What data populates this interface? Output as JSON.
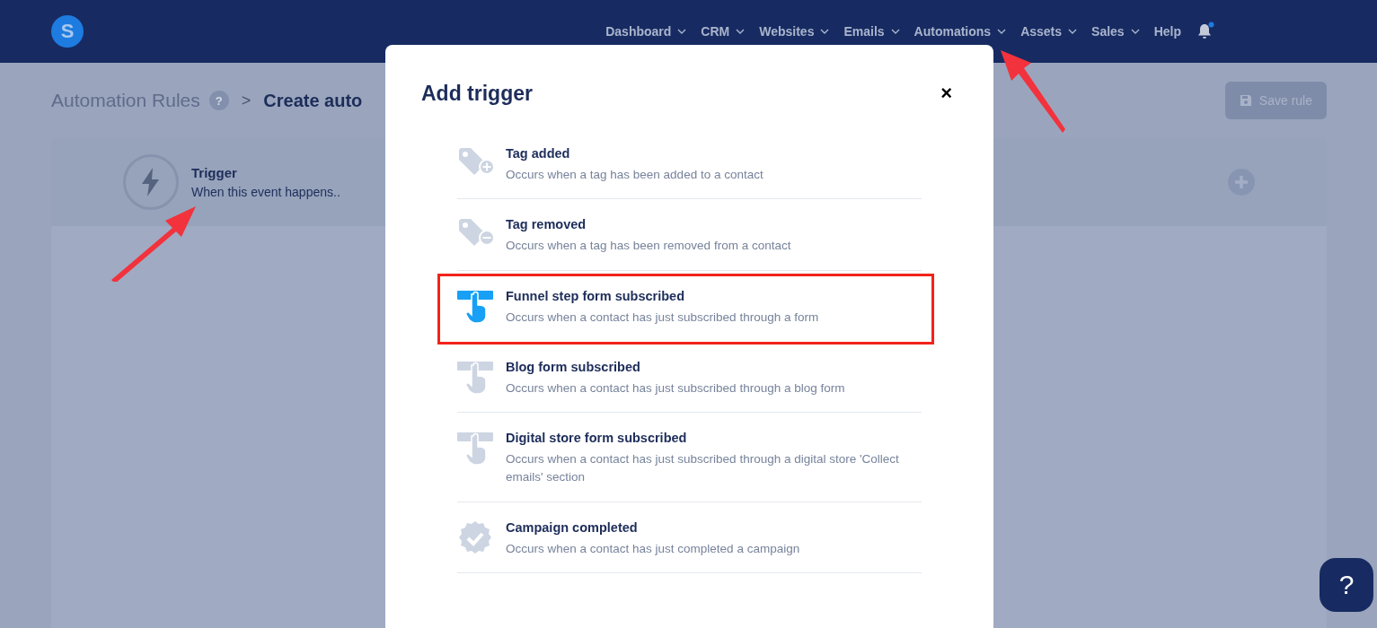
{
  "nav": {
    "logo": "S",
    "items": [
      {
        "label": "Dashboard",
        "dropdown": true
      },
      {
        "label": "CRM",
        "dropdown": true
      },
      {
        "label": "Websites",
        "dropdown": true
      },
      {
        "label": "Emails",
        "dropdown": true
      },
      {
        "label": "Automations",
        "dropdown": true
      },
      {
        "label": "Assets",
        "dropdown": true
      },
      {
        "label": "Sales",
        "dropdown": true
      },
      {
        "label": "Help",
        "dropdown": false
      }
    ],
    "notification_dot": true
  },
  "breadcrumb": {
    "parent": "Automation Rules",
    "help": "?",
    "separator": ">",
    "current": "Create auto"
  },
  "save_button": {
    "label": "Save rule",
    "disabled": true
  },
  "trigger_card": {
    "title": "Trigger",
    "subtitle": "When this event happens.."
  },
  "modal": {
    "title": "Add trigger",
    "close": "×",
    "items": [
      {
        "kind": "tag-add",
        "title": "Tag added",
        "description": "Occurs when a tag has been added to a contact",
        "highlighted": false
      },
      {
        "kind": "tag-remove",
        "title": "Tag removed",
        "description": "Occurs when a tag has been removed from a contact",
        "highlighted": false
      },
      {
        "kind": "form-active",
        "title": "Funnel step form subscribed",
        "description": "Occurs when a contact has just subscribed through a form",
        "highlighted": true
      },
      {
        "kind": "form",
        "title": "Blog form subscribed",
        "description": "Occurs when a contact has just subscribed through a blog form",
        "highlighted": false
      },
      {
        "kind": "form",
        "title": "Digital store form subscribed",
        "description": "Occurs when a contact has just subscribed through a digital store 'Collect emails' section",
        "highlighted": false
      },
      {
        "kind": "badge-check",
        "title": "Campaign completed",
        "description": "Occurs when a contact has just completed a campaign",
        "highlighted": false
      }
    ]
  },
  "help_widget": {
    "label": "?"
  }
}
